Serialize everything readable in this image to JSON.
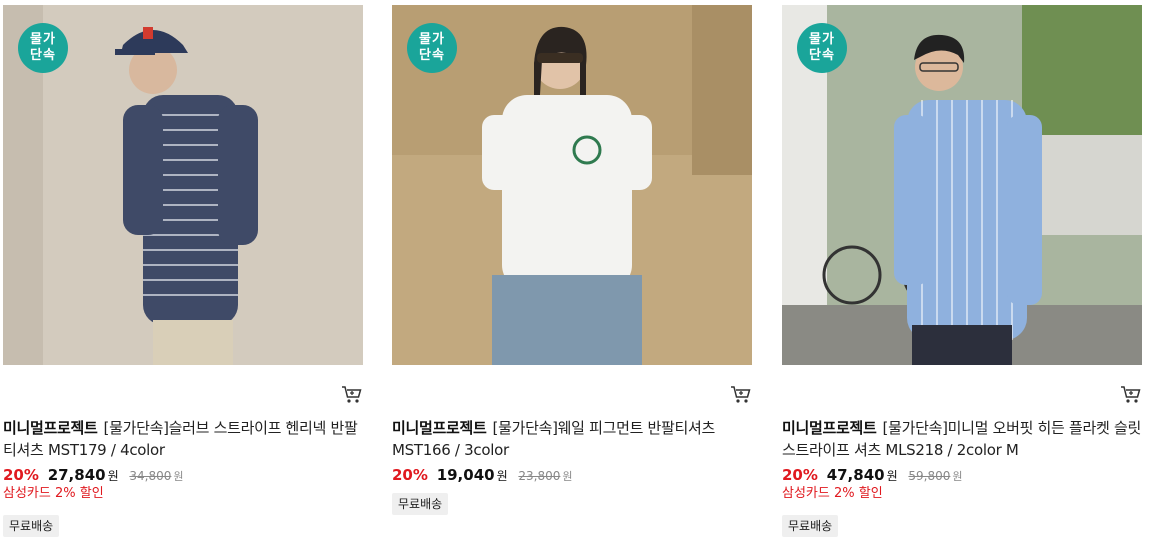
{
  "products": [
    {
      "badge": [
        "물가",
        "단속"
      ],
      "brand": "미니멀프로젝트",
      "name": "[물가단속]슬러브 스트라이프 헨리넥 반팔티셔츠 MST179 / 4color",
      "discount": "20%",
      "price": "27,840",
      "currency": "원",
      "original_price": "34,800",
      "card_discount": "삼성카드 2% 할인",
      "tag": "무료배송",
      "colors": {
        "bg": "#d3cbbe",
        "top": "#3f4a67",
        "bottom": "#d9cfb8"
      }
    },
    {
      "badge": [
        "물가",
        "단속"
      ],
      "brand": "미니멀프로젝트",
      "name": "[물가단속]웨일 피그먼트 반팔티셔츠 MST166 / 3color",
      "discount": "20%",
      "price": "19,040",
      "currency": "원",
      "original_price": "23,800",
      "card_discount": "",
      "tag": "무료배송",
      "colors": {
        "bg": "#b7a07a",
        "top": "#f3f3f1",
        "bottom": "#7f98ad"
      }
    },
    {
      "badge": [
        "물가",
        "단속"
      ],
      "brand": "미니멀프로젝트",
      "name": "[물가단속]미니멀 오버핏 히든 플라켓 슬릿 스트라이프 셔츠 MLS218 / 2color M",
      "discount": "20%",
      "price": "47,840",
      "currency": "원",
      "original_price": "59,800",
      "card_discount": "삼성카드 2% 할인",
      "tag": "무료배송",
      "colors": {
        "bg": "#9aa88f",
        "top": "#8fb1de",
        "bottom": "#2c2f3c"
      }
    }
  ],
  "icons": {
    "cart": "cart-icon"
  }
}
